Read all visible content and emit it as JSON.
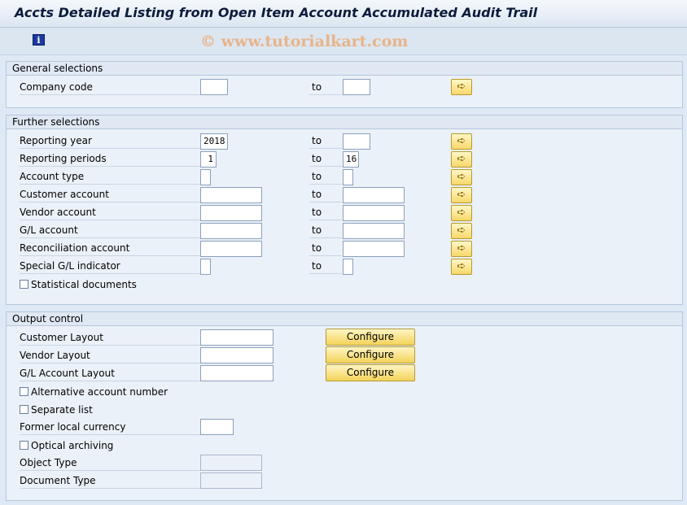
{
  "title": "Accts Detailed Listing from Open Item Account Accumulated Audit Trail",
  "watermark": "© www.tutorialkart.com",
  "icons": {
    "info": "info-icon",
    "arrow": "arrow-right-icon"
  },
  "general": {
    "header": "General selections",
    "company_code": {
      "label": "Company code",
      "to": "to",
      "low": "",
      "high": ""
    }
  },
  "further": {
    "header": "Further selections",
    "reporting_year": {
      "label": "Reporting year",
      "to": "to",
      "low": "2018",
      "high": ""
    },
    "reporting_periods": {
      "label": "Reporting periods",
      "to": "to",
      "low": "1",
      "high": "16"
    },
    "account_type": {
      "label": "Account type",
      "to": "to",
      "low": "",
      "high": ""
    },
    "customer_account": {
      "label": "Customer account",
      "to": "to",
      "low": "",
      "high": ""
    },
    "vendor_account": {
      "label": "Vendor account",
      "to": "to",
      "low": "",
      "high": ""
    },
    "gl_account": {
      "label": "G/L account",
      "to": "to",
      "low": "",
      "high": ""
    },
    "reconciliation_account": {
      "label": "Reconciliation account",
      "to": "to",
      "low": "",
      "high": ""
    },
    "special_gl": {
      "label": "Special G/L indicator",
      "to": "to",
      "low": "",
      "high": ""
    },
    "statistical_documents": "Statistical documents"
  },
  "output": {
    "header": "Output control",
    "customer_layout": {
      "label": "Customer Layout",
      "value": "",
      "button": "Configure"
    },
    "vendor_layout": {
      "label": "Vendor Layout",
      "value": "",
      "button": "Configure"
    },
    "gl_layout": {
      "label": "G/L Account Layout",
      "value": "",
      "button": "Configure"
    },
    "alt_account_number": "Alternative account number",
    "separate_list": "Separate list",
    "former_local_currency": {
      "label": "Former local currency",
      "value": ""
    },
    "optical_archiving": "Optical archiving",
    "object_type": {
      "label": "Object Type",
      "value": ""
    },
    "document_type": {
      "label": "Document Type",
      "value": ""
    }
  }
}
